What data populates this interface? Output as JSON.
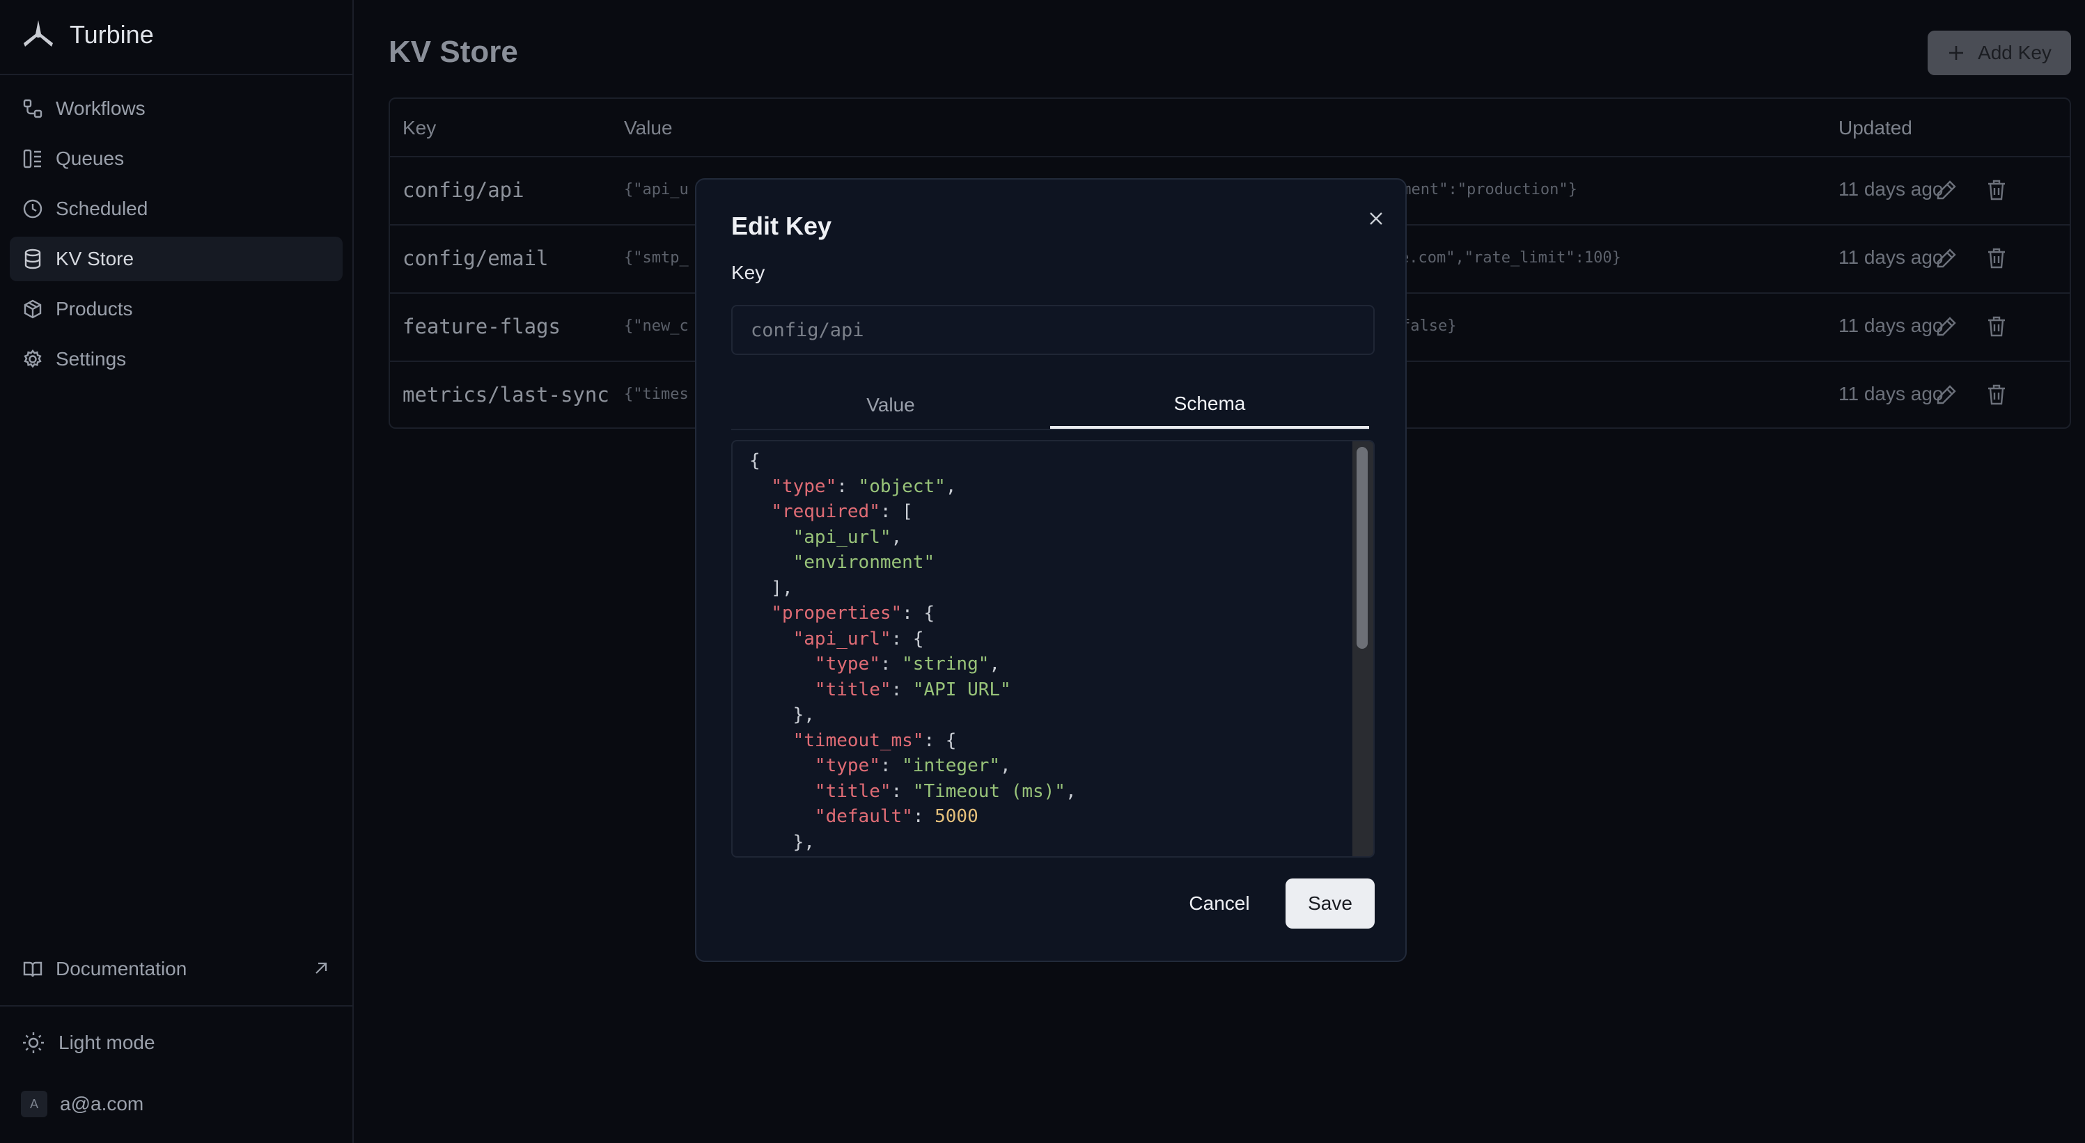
{
  "app": {
    "name": "Turbine"
  },
  "sidebar": {
    "items": [
      {
        "label": "Workflows",
        "icon": "workflow-icon"
      },
      {
        "label": "Queues",
        "icon": "queues-icon"
      },
      {
        "label": "Scheduled",
        "icon": "clock-icon"
      },
      {
        "label": "KV Store",
        "icon": "database-icon",
        "active": true
      },
      {
        "label": "Products",
        "icon": "package-icon"
      },
      {
        "label": "Settings",
        "icon": "gear-icon"
      }
    ],
    "documentation": "Documentation",
    "theme_toggle": "Light mode",
    "user": {
      "initial": "A",
      "email": "a@a.com"
    }
  },
  "page": {
    "title": "KV Store",
    "add_button": "Add Key"
  },
  "table": {
    "columns": [
      "Key",
      "Value",
      "Updated"
    ],
    "rows": [
      {
        "key": "config/api",
        "value_start": "{\"api_u",
        "value_end": "nment\":\"production\"}",
        "updated": "11 days ago"
      },
      {
        "key": "config/email",
        "value_start": "{\"smtp_",
        "value_end": "e.com\",\"rate_limit\":100}",
        "updated": "11 days ago"
      },
      {
        "key": "feature-flags",
        "value_start": "{\"new_c",
        "value_end": "false}",
        "updated": "11 days ago"
      },
      {
        "key": "metrics/last-sync",
        "value_start": "{\"times",
        "value_end": "",
        "updated": "11 days ago"
      }
    ]
  },
  "modal": {
    "title": "Edit Key",
    "key_label": "Key",
    "key_value": "config/api",
    "tabs": [
      "Value",
      "Schema"
    ],
    "active_tab": "Schema",
    "cancel": "Cancel",
    "save": "Save",
    "schema_lines": [
      [
        [
          "p",
          "{"
        ]
      ],
      [
        [
          "p",
          "  "
        ],
        [
          "k",
          "\"type\""
        ],
        [
          "p",
          ": "
        ],
        [
          "s",
          "\"object\""
        ],
        [
          "p",
          ","
        ]
      ],
      [
        [
          "p",
          "  "
        ],
        [
          "k",
          "\"required\""
        ],
        [
          "p",
          ": ["
        ]
      ],
      [
        [
          "p",
          "    "
        ],
        [
          "s",
          "\"api_url\""
        ],
        [
          "p",
          ","
        ]
      ],
      [
        [
          "p",
          "    "
        ],
        [
          "s",
          "\"environment\""
        ]
      ],
      [
        [
          "p",
          "  ],"
        ]
      ],
      [
        [
          "p",
          "  "
        ],
        [
          "k",
          "\"properties\""
        ],
        [
          "p",
          ": {"
        ]
      ],
      [
        [
          "p",
          "    "
        ],
        [
          "k",
          "\"api_url\""
        ],
        [
          "p",
          ": {"
        ]
      ],
      [
        [
          "p",
          "      "
        ],
        [
          "k",
          "\"type\""
        ],
        [
          "p",
          ": "
        ],
        [
          "s",
          "\"string\""
        ],
        [
          "p",
          ","
        ]
      ],
      [
        [
          "p",
          "      "
        ],
        [
          "k",
          "\"title\""
        ],
        [
          "p",
          ": "
        ],
        [
          "s",
          "\"API URL\""
        ]
      ],
      [
        [
          "p",
          "    },"
        ]
      ],
      [
        [
          "p",
          "    "
        ],
        [
          "k",
          "\"timeout_ms\""
        ],
        [
          "p",
          ": {"
        ]
      ],
      [
        [
          "p",
          "      "
        ],
        [
          "k",
          "\"type\""
        ],
        [
          "p",
          ": "
        ],
        [
          "s",
          "\"integer\""
        ],
        [
          "p",
          ","
        ]
      ],
      [
        [
          "p",
          "      "
        ],
        [
          "k",
          "\"title\""
        ],
        [
          "p",
          ": "
        ],
        [
          "s",
          "\"Timeout (ms)\""
        ],
        [
          "p",
          ","
        ]
      ],
      [
        [
          "p",
          "      "
        ],
        [
          "k",
          "\"default\""
        ],
        [
          "p",
          ": "
        ],
        [
          "n",
          "5000"
        ]
      ],
      [
        [
          "p",
          "    },"
        ]
      ]
    ]
  },
  "colors": {
    "background": "#090b11",
    "modal_bg": "#0e1421",
    "json_key": "#e06c75",
    "json_string": "#98c379",
    "json_number": "#e5c07b"
  }
}
